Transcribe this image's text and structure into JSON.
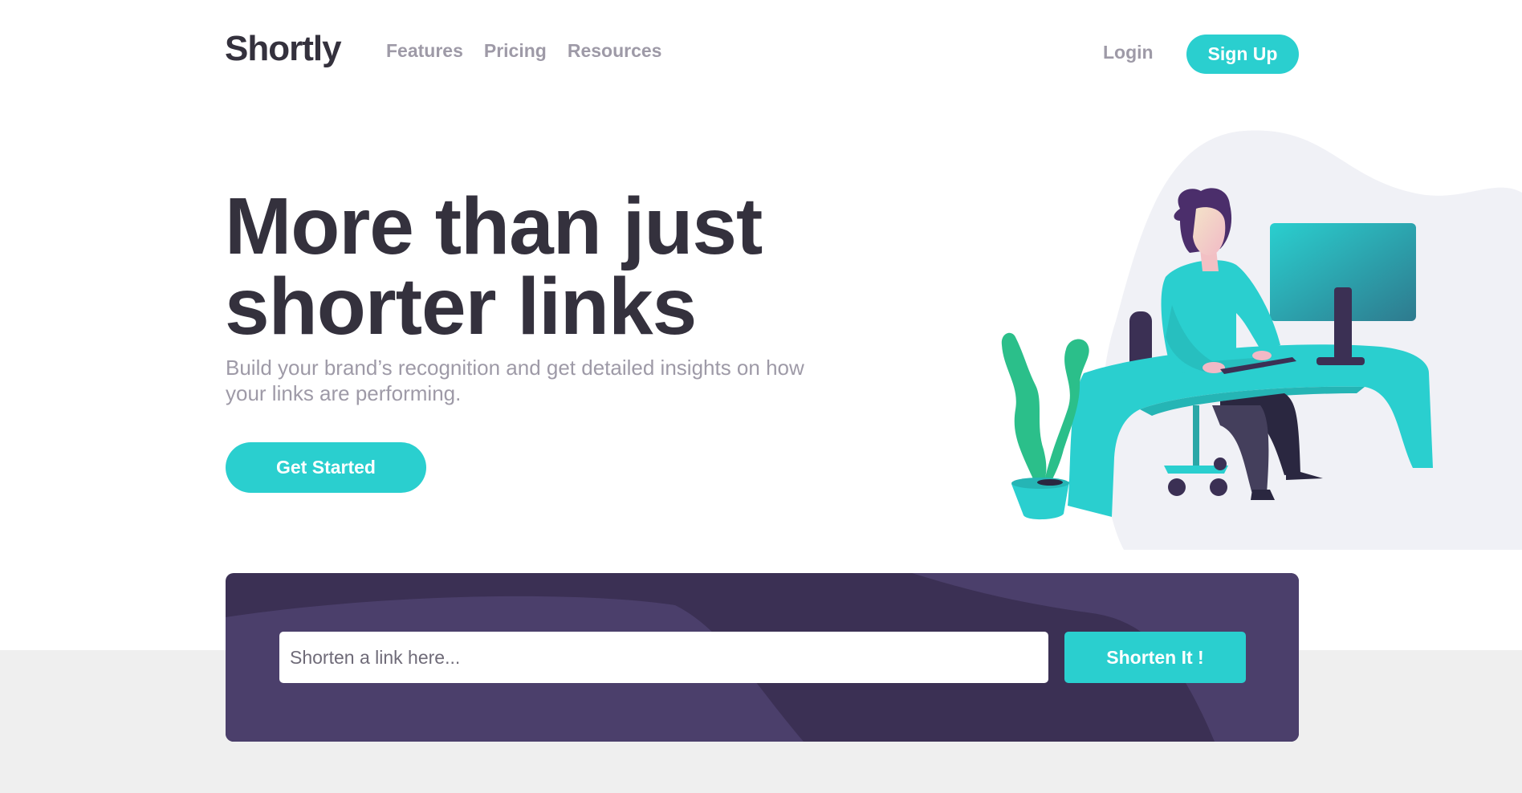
{
  "header": {
    "logo": "Shortly",
    "nav": [
      "Features",
      "Pricing",
      "Resources"
    ],
    "login_label": "Login",
    "signup_label": "Sign Up"
  },
  "hero": {
    "title": "More than just shorter links",
    "subtitle": "Build your brand’s recognition and get detailed insights on how your links are performing.",
    "cta_label": "Get Started",
    "illustration_icon": "person-working-at-desk-illustration"
  },
  "shorten": {
    "placeholder": "Shorten a link here...",
    "value": "",
    "button_label": "Shorten It !"
  },
  "colors": {
    "brand_cyan": "#2acfcf",
    "dark_violet": "#3b3054",
    "panel_shape": "#4b3f6b",
    "heading": "#34313d",
    "muted_text": "#9e9aa7",
    "band_gray": "#efefef"
  }
}
